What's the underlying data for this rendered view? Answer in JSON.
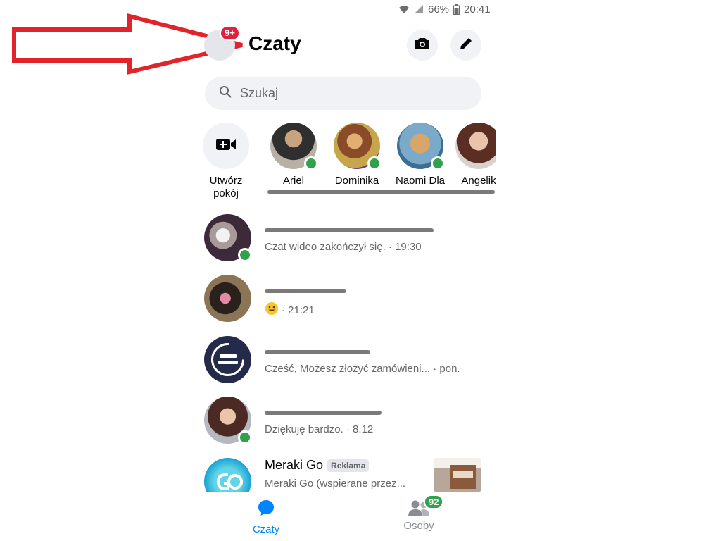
{
  "status_bar": {
    "battery": "66%",
    "time": "20:41"
  },
  "header": {
    "title": "Czaty",
    "notification_badge": "9+"
  },
  "search": {
    "placeholder": "Szukaj"
  },
  "stories": {
    "create_room_label_line1": "Utwórz",
    "create_room_label_line2": "pokój",
    "people": [
      {
        "first_name": "Ariel",
        "online": true
      },
      {
        "first_name": "Dominika",
        "online": true
      },
      {
        "first_name": "Naomi Dla",
        "online": true
      },
      {
        "first_name": "Angelik",
        "online": false
      }
    ]
  },
  "chats": [
    {
      "preview": "Czat wideo zakończył się. · 19:30",
      "online": true
    },
    {
      "preview": "· 21:21",
      "online": false
    },
    {
      "preview": "Cześć, Możesz złożyć zamówieni... · pon.",
      "online": false
    },
    {
      "preview": "Dziękuję bardzo. · 8.12",
      "online": true
    },
    {
      "name": "Meraki Go",
      "ad_label": "Reklama",
      "preview": "Meraki Go (wspierane przez...",
      "online": false
    }
  ],
  "bottom_nav": {
    "chats_label": "Czaty",
    "people_label": "Osoby",
    "people_badge": "92"
  },
  "colors": {
    "accent": "#0084ff",
    "online": "#31a24c",
    "badge_red": "#e41e3f",
    "annotation_arrow": "#e0242b"
  }
}
